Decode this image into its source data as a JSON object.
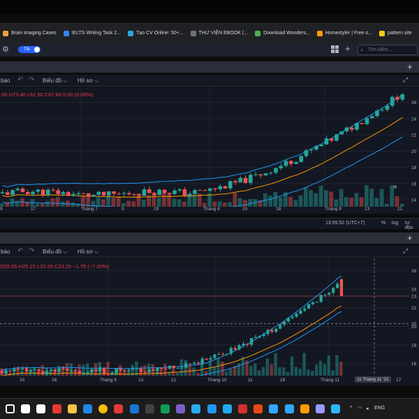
{
  "bookmarks": [
    {
      "label": "Brain imaging Cases",
      "color": "#e8a33c"
    },
    {
      "label": "IELTS Writing Task 2...",
      "color": "#3b82f6"
    },
    {
      "label": "Tạo CV Online: 50+...",
      "color": "#2aa7e0"
    },
    {
      "label": "THƯ VIỆN EBOOK (...",
      "color": "#6b7280"
    },
    {
      "label": "Download Wonders...",
      "color": "#4caf50"
    },
    {
      "label": "Homestyler | Free o...",
      "color": "#f59e0b"
    },
    {
      "label": "pattern site",
      "color": "#facc15"
    }
  ],
  "app": {
    "toggle_label": "Tối",
    "search_placeholder": "Tìm kiếm...",
    "plus": "+"
  },
  "toolbar": {
    "indicator": "báo",
    "chart_label": "Biểu đồ",
    "profile_label": "Hồ sơ",
    "caret": "⌵"
  },
  "panel1": {
    "ohlc": ".00  H73.40  L61.50  C67.80  0.00 (0.00%)",
    "price_ticks": [
      "26",
      "24",
      "22",
      "20",
      "18",
      "16",
      "14"
    ],
    "x_ticks": [
      "9",
      "17",
      "Tháng 7",
      "9",
      "19",
      "Tháng 8",
      "10",
      "18",
      "Tháng 9",
      "13",
      "21"
    ],
    "time": "13:55:52 (UTC+7)",
    "status": [
      "%",
      "log",
      "tự độn"
    ]
  },
  "panel2": {
    "ohlc": "O25.05  H25.15  L23.25  C23.25  −1.75 (−7.00%)",
    "price_ticks": [
      "26",
      "24",
      "23.",
      "22",
      "20",
      "20.",
      "18",
      "16"
    ],
    "x_ticks": [
      "10",
      "18",
      "Tháng 9",
      "13",
      "21",
      "Tháng 10",
      "11",
      "19",
      "Tháng 11",
      "17"
    ],
    "crosshair_label": "11 Tháng 11 '21",
    "time": "13:55:52 (UTC+7)",
    "status": [
      "%",
      "log",
      "tự độn"
    ]
  },
  "taskbar": {
    "lang": "ENG",
    "icons": [
      "windows-icon",
      "search-icon",
      "task-view-icon",
      "chrome-red-icon",
      "explorer-icon",
      "edge-icon",
      "chrome-icon",
      "opera-icon",
      "mail-icon",
      "store-icon",
      "edge-dev-icon",
      "viber-icon",
      "telegram-icon",
      "zalo-icon",
      "vscode-icon",
      "acrobat-icon",
      "office-icon",
      "photoshop-icon",
      "lightroom-classic-icon",
      "illustrator-icon",
      "rush-icon",
      "wps-icon"
    ]
  },
  "chart_data": [
    {
      "type": "candlestick",
      "title": "",
      "ylim": [
        13.5,
        27.5
      ],
      "y_ticks": [
        14,
        16,
        18,
        20,
        22,
        24,
        26
      ]
    },
    {
      "type": "candlestick",
      "title": "",
      "ylim": [
        15,
        27
      ],
      "y_ticks": [
        16,
        18,
        20,
        22,
        24,
        26
      ],
      "last_close": 23.25,
      "open": 25.05,
      "high": 25.15,
      "low": 23.25,
      "close": 23.25
    }
  ]
}
